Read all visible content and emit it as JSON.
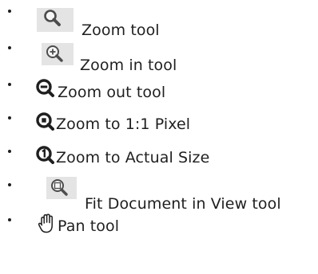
{
  "tools": [
    {
      "label": "Zoom tool",
      "icon": "magnifier-icon"
    },
    {
      "label": "Zoom in tool",
      "icon": "zoom-in-icon"
    },
    {
      "label": "Zoom out tool",
      "icon": "zoom-out-icon"
    },
    {
      "label": "Zoom to 1:1 Pixel",
      "icon": "zoom-to-pixel-icon"
    },
    {
      "label": "Zoom to Actual Size",
      "icon": "zoom-actual-size-icon"
    },
    {
      "label": "Fit Document in View tool",
      "icon": "fit-document-icon"
    },
    {
      "label": "Pan tool",
      "icon": "hand-icon"
    }
  ]
}
